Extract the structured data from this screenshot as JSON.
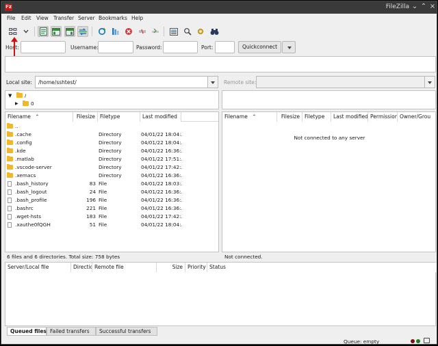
{
  "window": {
    "title": "FileZilla",
    "app_icon": "Fz",
    "minimize": "⌄",
    "maximize": "⌃",
    "close": "×"
  },
  "menu": [
    "File",
    "Edit",
    "View",
    "Transfer",
    "Server",
    "Bookmarks",
    "Help"
  ],
  "toolbar": {
    "icons": [
      "site-manager-icon",
      "site-manager-dropdown-icon",
      "toggle-message-log-icon",
      "toggle-local-tree-icon",
      "toggle-remote-tree-icon",
      "toggle-transfer-queue-icon",
      "refresh-icon",
      "process-queue-icon",
      "cancel-icon",
      "disconnect-icon",
      "reconnect-icon",
      "directory-listing-filters-icon",
      "toggle-comparison-icon",
      "sync-browsing-icon",
      "search-remote-icon"
    ]
  },
  "quickconnect": {
    "host_label": "Host:",
    "username_label": "Username:",
    "password_label": "Password:",
    "port_label": "Port:",
    "host_value": "",
    "username_value": "",
    "password_value": "",
    "port_value": "",
    "button": "Quickconnect"
  },
  "local": {
    "site_label": "Local site:",
    "site_path": "/home/sshtest/",
    "tree": [
      {
        "expander": "▼",
        "label": "/"
      },
      {
        "expander": "▶",
        "label": "0"
      }
    ],
    "columns": [
      "Filename",
      "Filesize",
      "Filetype",
      "Last modified"
    ],
    "sort_indicator": "⌃",
    "rows": [
      {
        "name": "..",
        "size": "",
        "type": "",
        "modified": "",
        "kind": "folder"
      },
      {
        "name": ".cache",
        "size": "",
        "type": "Directory",
        "modified": "04/01/22 18:04:...",
        "kind": "folder"
      },
      {
        "name": ".config",
        "size": "",
        "type": "Directory",
        "modified": "04/01/22 18:04:...",
        "kind": "folder"
      },
      {
        "name": ".kde",
        "size": "",
        "type": "Directory",
        "modified": "04/01/22 16:36:...",
        "kind": "folder"
      },
      {
        "name": ".matlab",
        "size": "",
        "type": "Directory",
        "modified": "04/01/22 17:51:...",
        "kind": "folder"
      },
      {
        "name": ".vscode-server",
        "size": "",
        "type": "Directory",
        "modified": "04/01/22 17:42:...",
        "kind": "folder"
      },
      {
        "name": ".xemacs",
        "size": "",
        "type": "Directory",
        "modified": "04/01/22 16:36:...",
        "kind": "folder"
      },
      {
        "name": ".bash_history",
        "size": "83",
        "type": "File",
        "modified": "04/01/22 18:03:...",
        "kind": "file"
      },
      {
        "name": ".bash_logout",
        "size": "24",
        "type": "File",
        "modified": "04/01/22 16:36:...",
        "kind": "file"
      },
      {
        "name": ".bash_profile",
        "size": "196",
        "type": "File",
        "modified": "04/01/22 16:36:...",
        "kind": "file"
      },
      {
        "name": ".bashrc",
        "size": "221",
        "type": "File",
        "modified": "04/01/22 16:36:...",
        "kind": "file"
      },
      {
        "name": ".wget-hsts",
        "size": "183",
        "type": "File",
        "modified": "04/01/22 17:42:...",
        "kind": "file"
      },
      {
        "name": ".xauthe0fQGH",
        "size": "51",
        "type": "File",
        "modified": "04/01/22 18:04:...",
        "kind": "file"
      }
    ],
    "status": "6 files and 6 directories. Total size: 758 bytes"
  },
  "remote": {
    "site_label": "Remote site:",
    "site_path": "",
    "columns": [
      "Filename",
      "Filesize",
      "Filetype",
      "Last modified",
      "Permission",
      "Owner/Grou"
    ],
    "sort_indicator": "⌃",
    "empty_message": "Not connected to any server",
    "status": "Not connected."
  },
  "queue": {
    "columns": [
      "Server/Local file",
      "Directio",
      "Remote file",
      "Size",
      "Priority",
      "Status"
    ],
    "tabs": [
      "Queued files",
      "Failed transfers",
      "Successful transfers"
    ],
    "status": "Queue: empty"
  },
  "colors": {
    "folder": "#f1b728",
    "arrow": "#d01010",
    "title_bar": "#3a3a3a",
    "indicator_red": "#7a1010",
    "indicator_green": "#1f7a1f"
  }
}
